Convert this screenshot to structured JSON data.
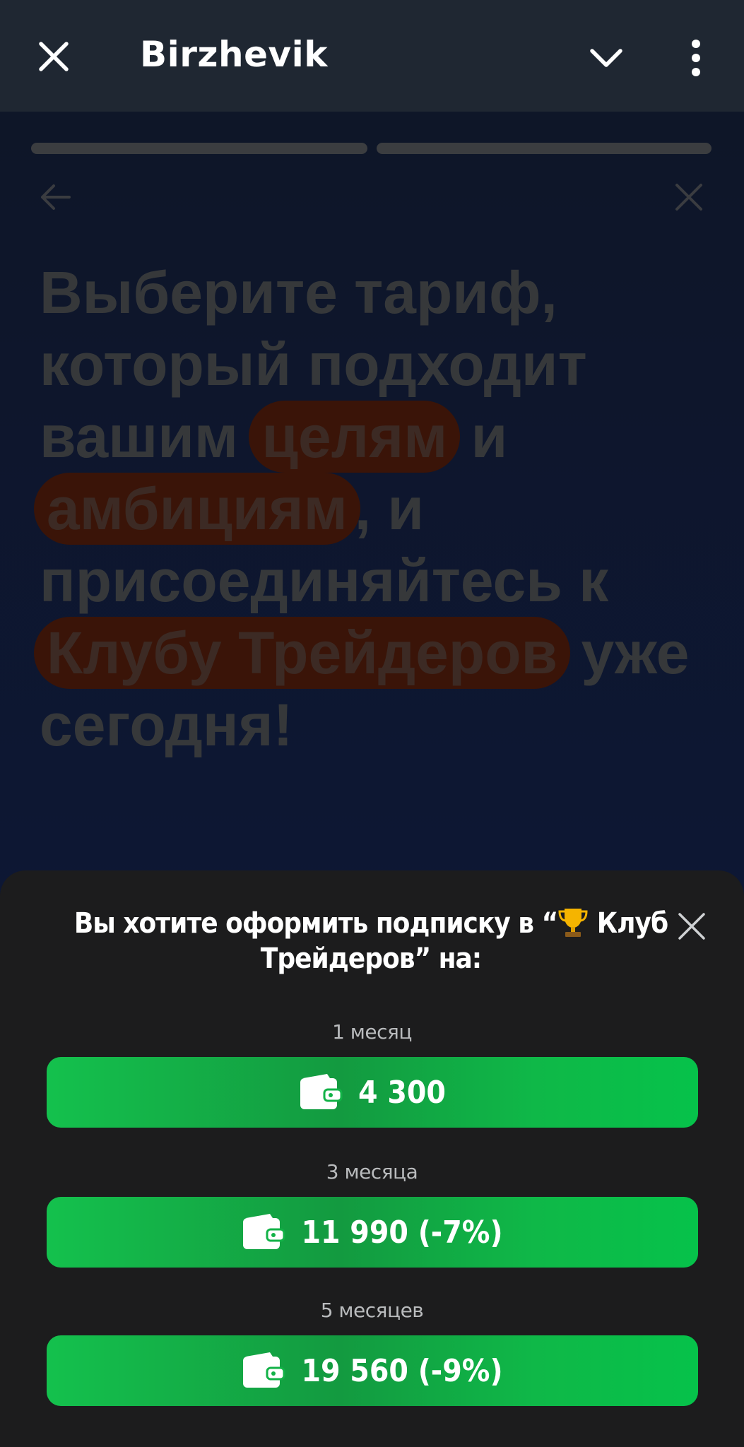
{
  "appbar": {
    "title": "Birzhevik",
    "close_icon": "close-icon",
    "dropdown_icon": "chevron-down-icon",
    "menu_icon": "more-vert-icon"
  },
  "page": {
    "progress_segments": 2,
    "headline": {
      "line1": "Выберите тариф,",
      "line2": "который подходит",
      "line3_plain": "вашим",
      "line3_highlight": "целям",
      "line3_tail": "и",
      "line4_highlight": "амбициям",
      "line4_tail": ", и",
      "line5": "присоединяйтесь к",
      "line6_highlight": "Клубу Трейдеров",
      "line6_tail": "уже",
      "line7": "сегодня!"
    }
  },
  "sheet": {
    "question_before": "Вы хотите оформить подписку в “",
    "question_club": " Клуб Трейдеров” на:",
    "plans": [
      {
        "label": "1 месяц",
        "price": "4 300"
      },
      {
        "label": "3 месяца",
        "price": "11 990 (-7%)"
      },
      {
        "label": "5 месяцев",
        "price": "19 560 (-9%)"
      }
    ]
  },
  "colors": {
    "button_green": "#0fbf48",
    "highlight": "#3a1408",
    "appbar": "#1f2732",
    "sheet": "#1c1c1d"
  }
}
